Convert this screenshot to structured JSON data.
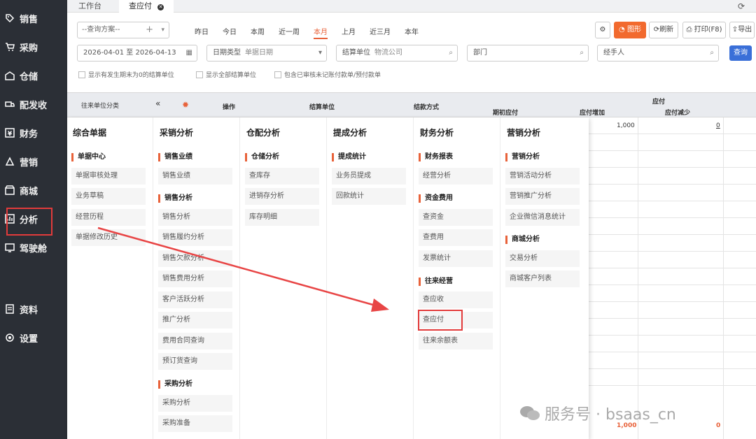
{
  "sidebar": {
    "items": [
      {
        "label": "销售",
        "icon": "tag-icon"
      },
      {
        "label": "采购",
        "icon": "cart-icon"
      },
      {
        "label": "仓储",
        "icon": "warehouse-icon"
      },
      {
        "label": "配发收",
        "icon": "truck-icon"
      },
      {
        "label": "财务",
        "icon": "yen-icon"
      },
      {
        "label": "营销",
        "icon": "marketing-icon"
      },
      {
        "label": "商城",
        "icon": "store-icon"
      },
      {
        "label": "分析",
        "icon": "analysis-icon"
      },
      {
        "label": "驾驶舱",
        "icon": "cockpit-icon"
      },
      {
        "label": "资料",
        "icon": "doc-icon"
      },
      {
        "label": "设置",
        "icon": "gear-icon"
      }
    ]
  },
  "tabs": {
    "workbench": "工作台",
    "active": "查应付"
  },
  "toolbar": {
    "scheme_placeholder": "--查询方案--",
    "date_shortcuts": [
      "昨日",
      "今日",
      "本周",
      "近一周",
      "本月",
      "上月",
      "近三月",
      "本年"
    ],
    "active_shortcut": "本月",
    "buttons": {
      "chart": "图形",
      "refresh": "刷新",
      "print": "打印(F8)",
      "export": "导出"
    }
  },
  "filters": {
    "date_range": "2026-04-01 至 2026-04-13",
    "date_type_label": "日期类型",
    "date_type_value": "单据日期",
    "settle_unit_label": "结算单位",
    "settle_unit_value": "物流公司",
    "department": "部门",
    "handler": "经手人",
    "query": "查询"
  },
  "checkboxes": [
    "显示有发生期末为0的结算单位",
    "显示全部结算单位",
    "包含已审核未记账付款单/预付款单"
  ],
  "table": {
    "category_label": "往来单位分类",
    "headers": {
      "op": "操作",
      "unit": "结算单位",
      "method": "结款方式",
      "group": "应付",
      "opening": "期初应付",
      "increase": "应付增加",
      "decrease": "应付减少"
    },
    "row1": {
      "increase": "1,000",
      "decrease": "0"
    },
    "footer_total": "1,000",
    "footer_zero": "0"
  },
  "menu": {
    "columns": [
      {
        "title": "综合单据",
        "sections": [
          {
            "name": "单据中心",
            "items": [
              "单据审核处理",
              "业务草稿",
              "经营历程",
              "单据修改历史"
            ]
          }
        ]
      },
      {
        "title": "采销分析",
        "sections": [
          {
            "name": "销售业绩",
            "items": [
              "销售业绩"
            ]
          },
          {
            "name": "销售分析",
            "items": [
              "销售分析",
              "销售履约分析",
              "销售欠款分析",
              "销售费用分析",
              "客户活跃分析",
              "推广分析",
              "费用合同查询",
              "预订货查询"
            ]
          },
          {
            "name": "采购分析",
            "items": [
              "采购分析",
              "采购准备"
            ]
          }
        ]
      },
      {
        "title": "仓配分析",
        "sections": [
          {
            "name": "仓储分析",
            "items": [
              "查库存",
              "进销存分析",
              "库存明细"
            ]
          }
        ]
      },
      {
        "title": "提成分析",
        "sections": [
          {
            "name": "提成统计",
            "items": [
              "业务员提成",
              "回款统计"
            ]
          }
        ]
      },
      {
        "title": "财务分析",
        "sections": [
          {
            "name": "财务报表",
            "items": [
              "经营分析"
            ]
          },
          {
            "name": "资金费用",
            "items": [
              "查资金",
              "查费用",
              "发票统计"
            ]
          },
          {
            "name": "往来经营",
            "items": [
              "查应收",
              "查应付",
              "往来余额表"
            ]
          }
        ]
      },
      {
        "title": "营销分析",
        "sections": [
          {
            "name": "营销分析",
            "items": [
              "营销活动分析",
              "营销推广分析",
              "企业微信消息统计"
            ]
          },
          {
            "name": "商城分析",
            "items": [
              "交易分析",
              "商城客户列表"
            ]
          }
        ]
      }
    ]
  },
  "watermark": "服务号 · bsaas_cn",
  "colors": {
    "accent": "#e8623a",
    "highlight": "#e23b3b",
    "sidebar": "#2b2f36",
    "primary_btn": "#3a6fd8"
  }
}
